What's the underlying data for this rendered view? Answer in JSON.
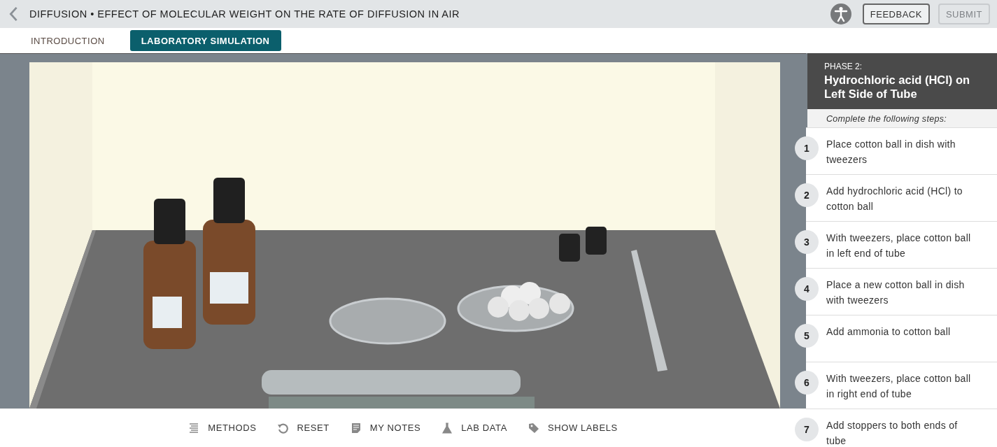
{
  "header": {
    "title": "DIFFUSION • EFFECT OF MOLECULAR WEIGHT ON THE RATE OF DIFFUSION IN AIR",
    "buttons": [
      {
        "label": "FEEDBACK",
        "disabled": false
      },
      {
        "label": "SUBMIT",
        "disabled": true
      }
    ]
  },
  "tabs": [
    {
      "label": "INTRODUCTION",
      "selected": false
    },
    {
      "label": "LABORATORY SIMULATION",
      "selected": true
    }
  ],
  "toolbar": [
    {
      "label": "METHODS",
      "kind": "methods"
    },
    {
      "label": "RESET",
      "kind": "reset"
    },
    {
      "label": "MY NOTES",
      "kind": "notes"
    },
    {
      "label": "LAB DATA",
      "kind": "flask"
    },
    {
      "label": "SHOW LABELS",
      "kind": "tag"
    }
  ],
  "panel": {
    "phase": "PHASE 2:",
    "title": "Hydrochloric acid (HCl) on Left Side of Tube",
    "instruction": "Complete the following steps:",
    "steps": [
      {
        "number": "1",
        "text": "Place cotton ball in dish with tweezers"
      },
      {
        "number": "2",
        "text": "Add hydrochloric acid (HCl) to cotton ball"
      },
      {
        "number": "3",
        "text": "With tweezers, place cotton ball in left end of tube"
      },
      {
        "number": "4",
        "text": "Place a new cotton ball in dish with tweezers"
      },
      {
        "number": "5",
        "text": "Add ammonia to cotton ball"
      },
      {
        "number": "6",
        "text": "With tweezers, place cotton ball in right end of tube"
      },
      {
        "number": "7",
        "text": "Add stoppers to both ends of tube"
      }
    ]
  }
}
